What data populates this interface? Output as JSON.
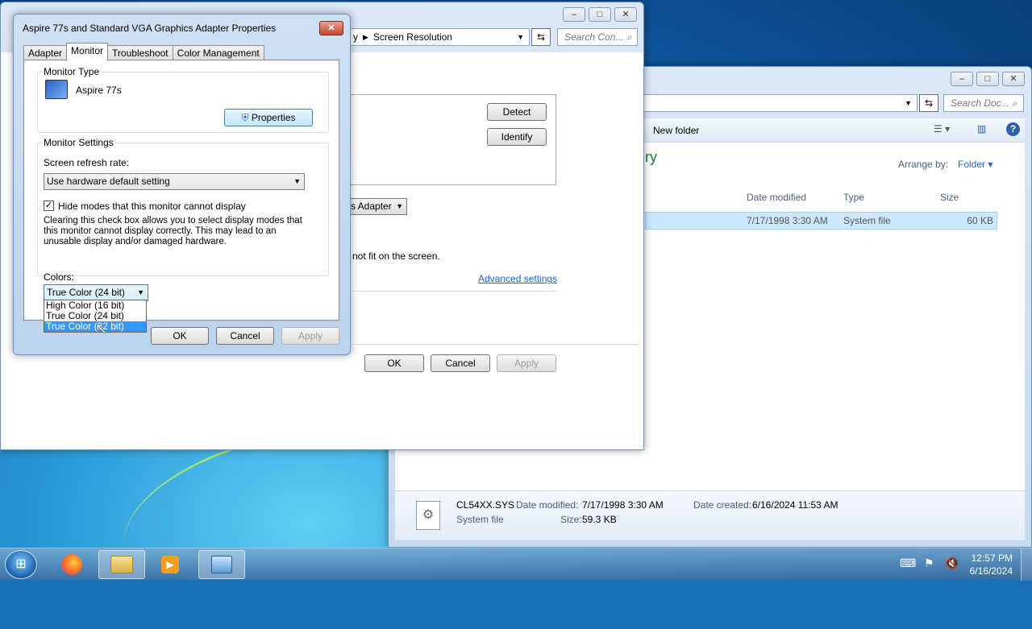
{
  "explorer": {
    "search_placeholder": "Search Doc...",
    "new_folder": "New folder",
    "library_title_fragment": "ry",
    "arrange_label": "Arrange by:",
    "arrange_value": "Folder",
    "columns": [
      "Date modified",
      "Type",
      "Size"
    ],
    "row": {
      "date": "7/17/1998 3:30 AM",
      "type": "System file",
      "size": "60 KB"
    },
    "details": {
      "filename": "CL54XX.SYS",
      "filetype": "System file",
      "date_modified_label": "Date modified:",
      "date_modified": "7/17/1998 3:30 AM",
      "size_label": "Size:",
      "size": "59.3 KB",
      "date_created_label": "Date created:",
      "date_created": "6/16/2024 11:53 AM"
    }
  },
  "screenres": {
    "breadcrumb_fragment": "y",
    "breadcrumb": "Screen Resolution",
    "search_placeholder": "Search Con...",
    "detect": "Detect",
    "identify": "Identify",
    "adapter_fragment": "s Adapter",
    "notfit_text": "not fit on the screen.",
    "advanced_settings": "Advanced settings",
    "ok": "OK",
    "cancel": "Cancel",
    "apply": "Apply"
  },
  "dialog": {
    "title": "Aspire 77s and Standard VGA Graphics Adapter Properties",
    "tabs": [
      "Adapter",
      "Monitor",
      "Troubleshoot",
      "Color Management"
    ],
    "monitor_type_label": "Monitor Type",
    "monitor_name": "Aspire 77s",
    "properties_button": "Properties",
    "monitor_settings_label": "Monitor Settings",
    "refresh_label": "Screen refresh rate:",
    "refresh_value": "Use hardware default setting",
    "hide_modes_label": "Hide modes that this monitor cannot display",
    "hide_modes_checked": true,
    "hide_modes_desc": "Clearing this check box allows you to select display modes that this monitor cannot display correctly. This may lead to an unusable display and/or damaged hardware.",
    "colors_label": "Colors:",
    "colors_value": "True Color (24 bit)",
    "colors_options": [
      "High Color (16 bit)",
      "True Color (24 bit)",
      "True Color (32 bit)"
    ],
    "ok": "OK",
    "cancel": "Cancel",
    "apply": "Apply"
  },
  "taskbar": {
    "time": "12:57 PM",
    "date": "6/16/2024"
  }
}
